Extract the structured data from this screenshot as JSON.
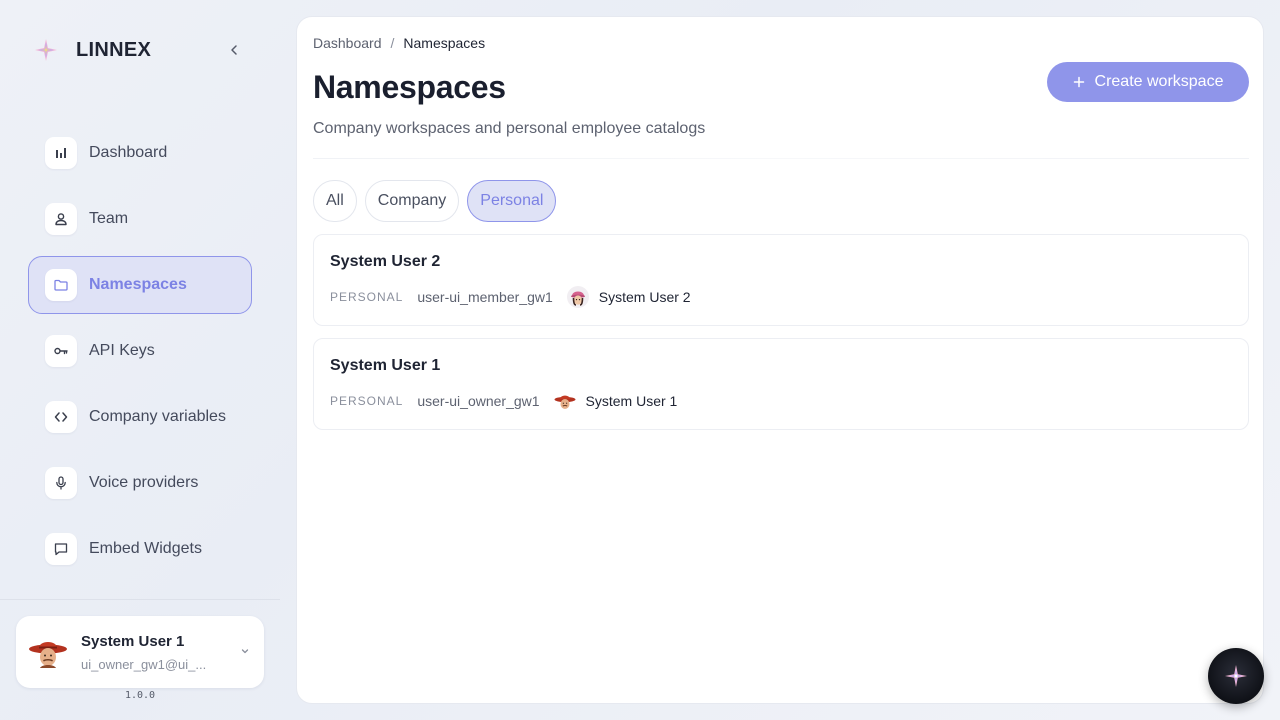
{
  "brand": {
    "name": "LINNEX"
  },
  "nav": {
    "items": [
      {
        "label": "Dashboard",
        "icon": "bar-chart-icon"
      },
      {
        "label": "Team",
        "icon": "user-icon"
      },
      {
        "label": "Namespaces",
        "icon": "folder-icon",
        "active": true
      },
      {
        "label": "API Keys",
        "icon": "key-icon"
      },
      {
        "label": "Company variables",
        "icon": "code-icon"
      },
      {
        "label": "Voice providers",
        "icon": "microphone-icon"
      },
      {
        "label": "Embed Widgets",
        "icon": "message-square-icon"
      }
    ]
  },
  "user": {
    "name": "System User 1",
    "email": "ui_owner_gw1@ui_..."
  },
  "version": "1.0.0",
  "breadcrumb": {
    "parent": "Dashboard",
    "separator": "/",
    "current": "Namespaces"
  },
  "page": {
    "title": "Namespaces",
    "subtitle": "Company workspaces and personal employee catalogs",
    "create_label": "Create workspace"
  },
  "filters": [
    {
      "label": "All"
    },
    {
      "label": "Company"
    },
    {
      "label": "Personal",
      "active": true
    }
  ],
  "namespaces": [
    {
      "title": "System User 2",
      "type": "PERSONAL",
      "slug": "user-ui_member_gw1",
      "owner": "System User 2"
    },
    {
      "title": "System User 1",
      "type": "PERSONAL",
      "slug": "user-ui_owner_gw1",
      "owner": "System User 1"
    }
  ],
  "colors": {
    "accent": "#8f95ea",
    "accent_text": "#7c82e4",
    "accent_bg": "#dfe2f6",
    "text_primary": "#1f2433",
    "text_muted": "#8a8f9c"
  }
}
